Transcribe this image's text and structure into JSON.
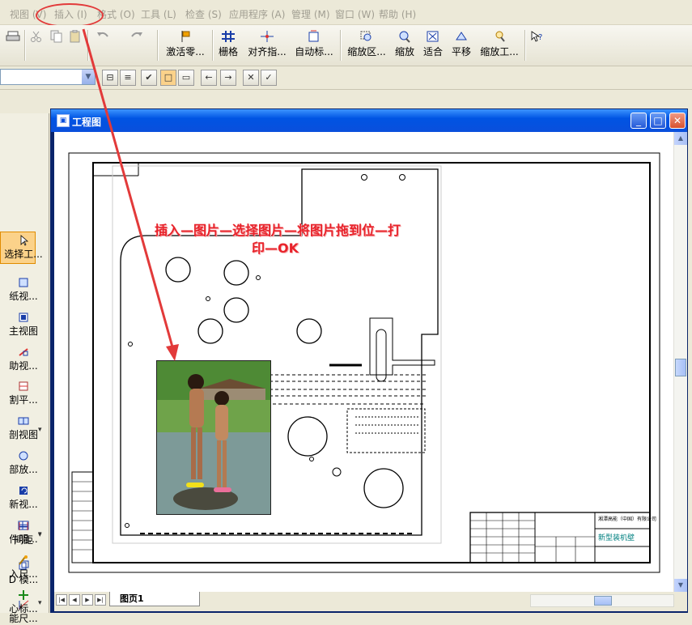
{
  "menu": {
    "items": [
      {
        "label": "视图 (V)"
      },
      {
        "label": "插入 (I)"
      },
      {
        "label": "格式 (O)"
      },
      {
        "label": "工具 (L)"
      },
      {
        "label": "检查 (S)"
      },
      {
        "label": "应用程序 (A)"
      },
      {
        "label": "管理 (M)"
      },
      {
        "label": "窗口 (W)"
      },
      {
        "label": "帮助 (H)"
      }
    ],
    "highlight_color": "#e23a3a"
  },
  "toolbar": {
    "buttons": [
      {
        "label": "激活零..."
      },
      {
        "label": "栅格"
      },
      {
        "label": "对齐指..."
      },
      {
        "label": "自动标..."
      },
      {
        "label": "缩放区..."
      },
      {
        "label": "缩放"
      },
      {
        "label": "适合"
      },
      {
        "label": "平移"
      },
      {
        "label": "缩放工..."
      }
    ]
  },
  "left_panel": {
    "items": [
      {
        "label": "选择工..."
      },
      {
        "label": "纸视..."
      },
      {
        "label": "主视图"
      },
      {
        "label": "助视..."
      },
      {
        "label": "割平..."
      },
      {
        "label": "剖视图"
      },
      {
        "label": "部放..."
      },
      {
        "label": "新视..."
      },
      {
        "label": "件明..."
      },
      {
        "label": "D 模..."
      },
      {
        "label": "能尺..."
      },
      {
        "label": "间距"
      },
      {
        "label": "入尺..."
      },
      {
        "label": "心标..."
      }
    ]
  },
  "document": {
    "title": "工程图",
    "sheet_tab": "图页1",
    "titleblock_name": "新型装机壁"
  },
  "annotation": {
    "line1": "插入—图片—选择图片—将图片拖到位—打",
    "line2": "印—OK",
    "color": "#e8232b"
  }
}
